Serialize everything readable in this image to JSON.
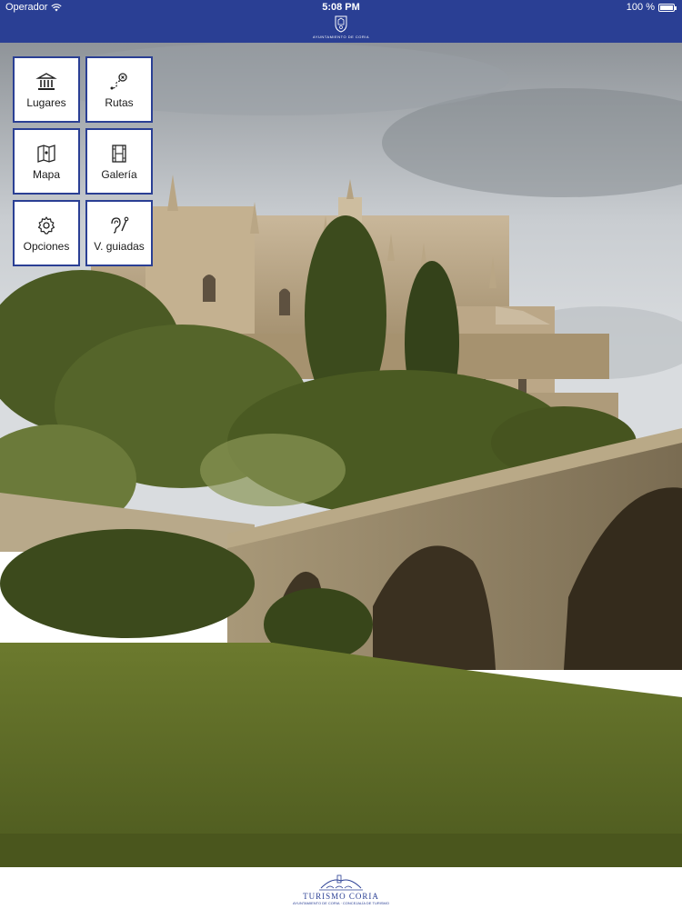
{
  "status_bar": {
    "carrier": "Operador",
    "time": "5:08 PM",
    "battery": "100 %",
    "wifi_icon": "wifi-icon",
    "battery_icon": "battery-icon"
  },
  "nav_bar": {
    "logo_subtitle": "AYUNTAMIENTO DE CORIA",
    "background_color": "#2a3f94"
  },
  "menu": {
    "items": [
      {
        "label": "Lugares",
        "icon": "building-icon"
      },
      {
        "label": "Rutas",
        "icon": "route-icon"
      },
      {
        "label": "Mapa",
        "icon": "map-icon"
      },
      {
        "label": "Galería",
        "icon": "film-icon"
      },
      {
        "label": "Opciones",
        "icon": "gear-icon"
      },
      {
        "label": "V. guiadas",
        "icon": "audio-guide-icon"
      }
    ],
    "border_color": "#2a3f94"
  },
  "footer": {
    "brand": "TURISMO CORIA",
    "tagline": "AYUNTAMIENTO DE CORIA · CONCEJALÍA DE TURISMO"
  }
}
